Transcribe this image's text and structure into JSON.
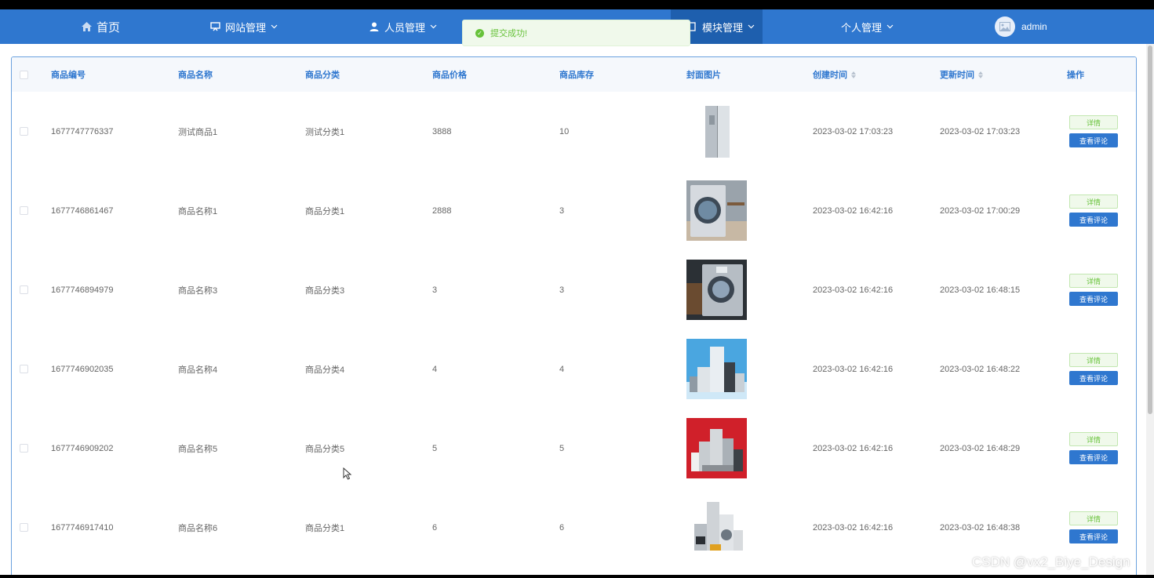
{
  "nav": {
    "home": "首页",
    "site_mgmt": "网站管理",
    "people_mgmt": "人员管理",
    "module_mgmt": "模块管理",
    "personal_mgmt": "个人管理",
    "user": "admin"
  },
  "toast": {
    "message": "提交成功!"
  },
  "table": {
    "headers": [
      "商品编号",
      "商品名称",
      "商品分类",
      "商品价格",
      "商品库存",
      "封面图片",
      "创建时间",
      "更新时间",
      "操作"
    ],
    "detail_label": "详情",
    "review_label": "查看评论",
    "rows": [
      {
        "id": "1677747776337",
        "name": "测试商品1",
        "category": "测试分类1",
        "price": "3888",
        "stock": "10",
        "image": "refrigerator",
        "created": "2023-03-02 17:03:23",
        "updated": "2023-03-02 17:03:23"
      },
      {
        "id": "1677746861467",
        "name": "商品名称1",
        "category": "商品分类1",
        "price": "2888",
        "stock": "3",
        "image": "washing-machine",
        "created": "2023-03-02 16:42:16",
        "updated": "2023-03-02 17:00:29"
      },
      {
        "id": "1677746894979",
        "name": "商品名称3",
        "category": "商品分类3",
        "price": "3",
        "stock": "3",
        "image": "washing-machine-dark",
        "created": "2023-03-02 16:42:16",
        "updated": "2023-03-02 16:48:15"
      },
      {
        "id": "1677746902035",
        "name": "商品名称4",
        "category": "商品分类4",
        "price": "4",
        "stock": "4",
        "image": "appliances-blue",
        "created": "2023-03-02 16:42:16",
        "updated": "2023-03-02 16:48:22"
      },
      {
        "id": "1677746909202",
        "name": "商品名称5",
        "category": "商品分类5",
        "price": "5",
        "stock": "5",
        "image": "appliances-red",
        "created": "2023-03-02 16:42:16",
        "updated": "2023-03-02 16:48:29"
      },
      {
        "id": "1677746917410",
        "name": "商品名称6",
        "category": "商品分类1",
        "price": "6",
        "stock": "6",
        "image": "appliances-white",
        "created": "2023-03-02 16:42:16",
        "updated": "2023-03-02 16:48:38"
      }
    ]
  },
  "watermark": "CSDN @vx2_Biye_Design",
  "colors": {
    "primary": "#2f77cf",
    "success": "#67c23a"
  }
}
